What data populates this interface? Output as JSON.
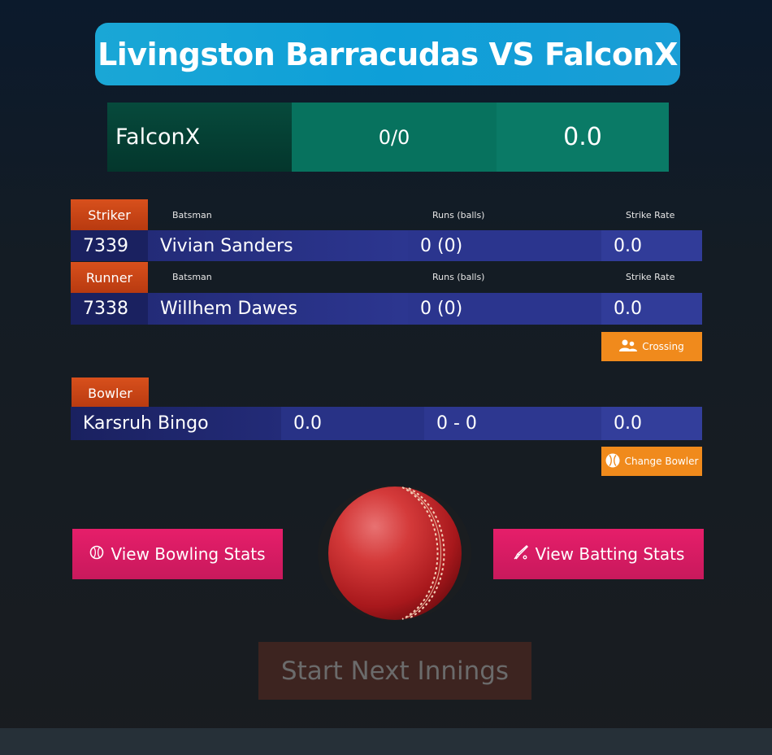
{
  "match": {
    "title": "Livingston Barracudas VS FalconX"
  },
  "score": {
    "team": "FalconX",
    "runs_wickets": "0/0",
    "overs": "0.0"
  },
  "striker": {
    "tag": "Striker",
    "headers": {
      "batsman": "Batsman",
      "runs": "Runs (balls)",
      "sr": "Strike Rate"
    },
    "id": "7339",
    "name": "Vivian Sanders",
    "runs": "0 (0)",
    "sr": "0.0"
  },
  "runner": {
    "tag": "Runner",
    "headers": {
      "batsman": "Batsman",
      "runs": "Runs (balls)",
      "sr": "Strike Rate"
    },
    "id": "7338",
    "name": "Willhem Dawes",
    "runs": "0 (0)",
    "sr": "0.0"
  },
  "actions": {
    "crossing": "Crossing",
    "change_bowler": "Change Bowler"
  },
  "bowler": {
    "tag": "Bowler",
    "name": "Karsruh Bingo",
    "economy": "0.0",
    "figures": "0 - 0",
    "overs": "0.0"
  },
  "buttons": {
    "bowling_stats": "View Bowling Stats",
    "batting_stats": "View Batting Stats",
    "start_next": "Start Next Innings"
  },
  "icons": {
    "crossing": "users-swap-icon",
    "change_bowler": "ball-icon",
    "bowling_stats": "ball-outline-icon",
    "batting_stats": "bat-icon",
    "center": "cricket-ball-icon"
  },
  "colors": {
    "accent": "#f08a1c",
    "title": "#1aa7d6",
    "pink": "#e61e6a",
    "tag": "#c8441a"
  }
}
